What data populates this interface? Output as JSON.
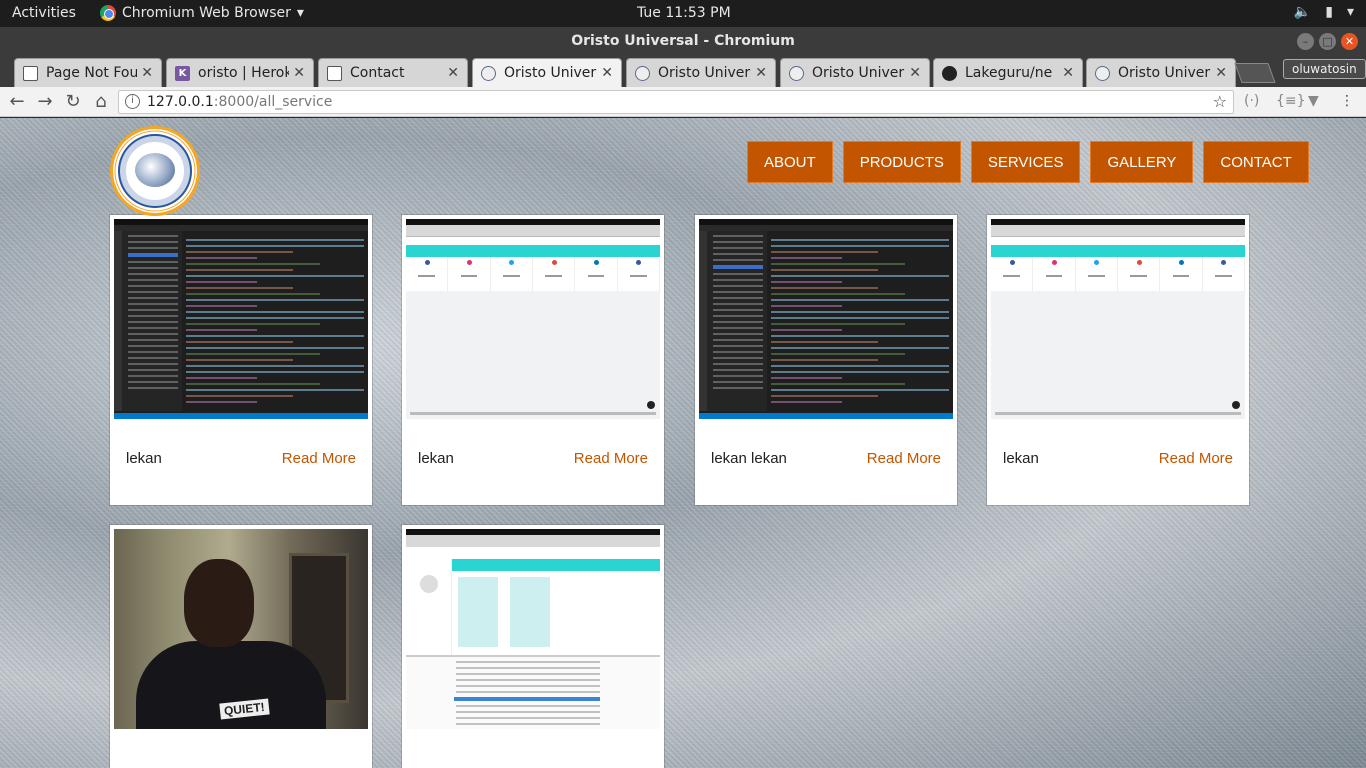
{
  "desktop": {
    "activities": "Activities",
    "app_name": "Chromium Web Browser",
    "clock": "Tue 11:53 PM"
  },
  "window": {
    "title": "Oristo Universal - Chromium",
    "profile": "oluwatosin"
  },
  "tabs": [
    {
      "label": "Page Not Fou",
      "favicon": "document-icon"
    },
    {
      "label": "oristo | Herok",
      "favicon": "heroku-icon"
    },
    {
      "label": "Contact",
      "favicon": "document-icon"
    },
    {
      "label": "Oristo Univer",
      "favicon": "oristo-icon",
      "active": true
    },
    {
      "label": "Oristo Univer",
      "favicon": "oristo-icon"
    },
    {
      "label": "Oristo Univer",
      "favicon": "oristo-icon"
    },
    {
      "label": "Lakeguru/ne",
      "favicon": "github-icon"
    },
    {
      "label": "Oristo Univer",
      "favicon": "oristo-icon"
    }
  ],
  "address": {
    "host": "127.0.0.1",
    "path": ":8000/all_service"
  },
  "site": {
    "nav": [
      "ABOUT",
      "PRODUCTS",
      "SERVICES",
      "GALLERY",
      "CONTACT"
    ],
    "accent": "#c45500",
    "services": [
      {
        "title": "lekan",
        "more": "Read More",
        "image": "code-editor-screenshot"
      },
      {
        "title": "lekan",
        "more": "Read More",
        "image": "dashboard-screenshot"
      },
      {
        "title": "lekan lekan",
        "more": "Read More",
        "image": "code-editor-screenshot"
      },
      {
        "title": "lekan",
        "more": "Read More",
        "image": "dashboard-screenshot"
      },
      {
        "title": "",
        "more": "",
        "image": "person-photo"
      },
      {
        "title": "",
        "more": "",
        "image": "devtools-screenshot"
      }
    ],
    "photo_shirt_text": "QUIET!"
  }
}
